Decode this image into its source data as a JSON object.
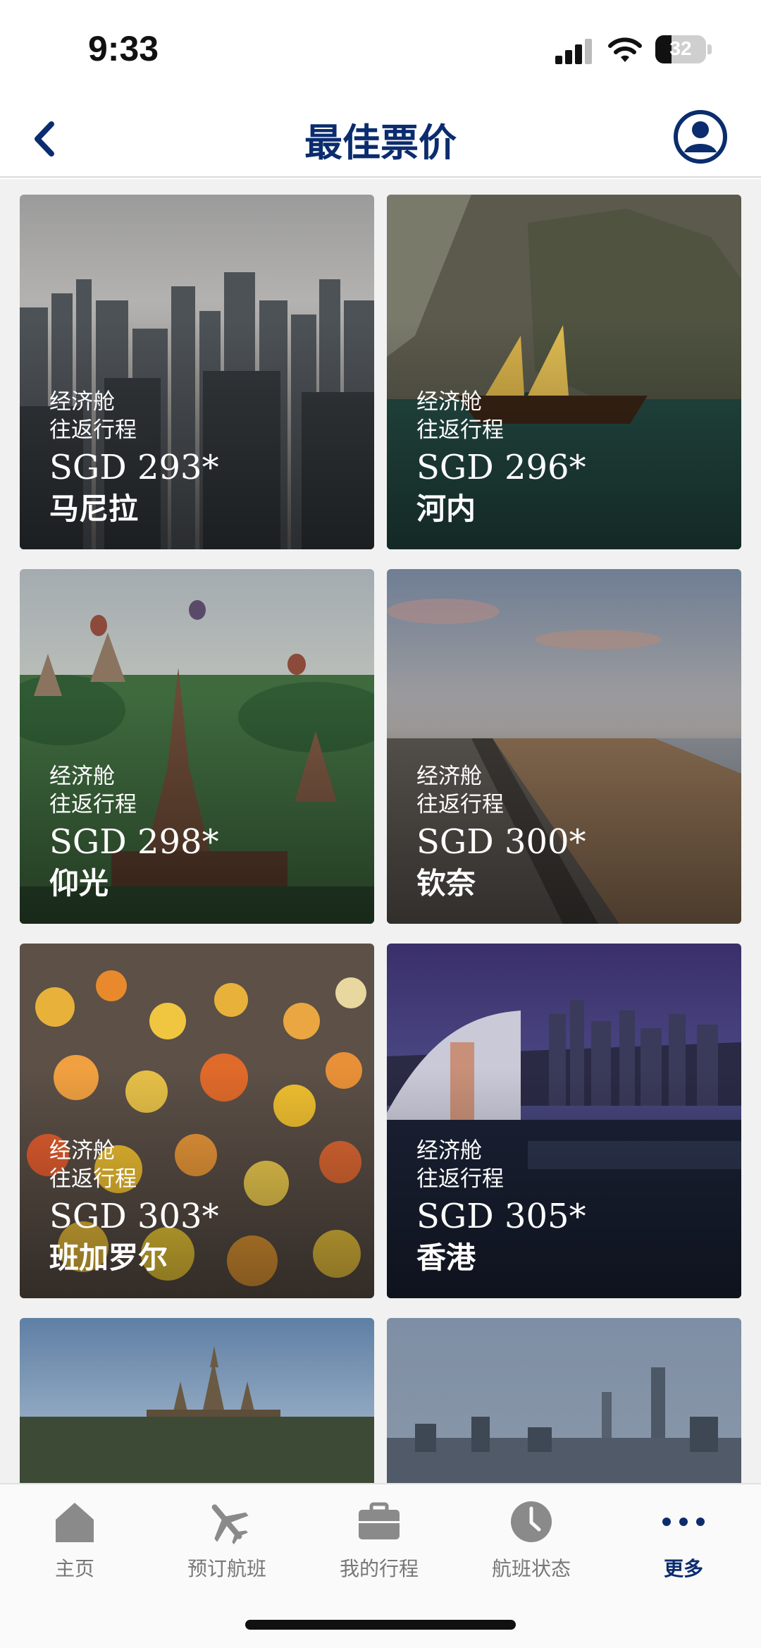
{
  "status_bar": {
    "time": "9:33",
    "battery": "32"
  },
  "header": {
    "title": "最佳票价"
  },
  "fares": [
    {
      "cabin": "经济舱",
      "trip": "往返行程",
      "price": "SGD 293*",
      "city": "马尼拉"
    },
    {
      "cabin": "经济舱",
      "trip": "往返行程",
      "price": "SGD 296*",
      "city": "河内"
    },
    {
      "cabin": "经济舱",
      "trip": "往返行程",
      "price": "SGD 298*",
      "city": "仰光"
    },
    {
      "cabin": "经济舱",
      "trip": "往返行程",
      "price": "SGD 300*",
      "city": "钦奈"
    },
    {
      "cabin": "经济舱",
      "trip": "往返行程",
      "price": "SGD 303*",
      "city": "班加罗尔"
    },
    {
      "cabin": "经济舱",
      "trip": "往返行程",
      "price": "SGD 305*",
      "city": "香港"
    }
  ],
  "tabs": [
    {
      "label": "主页",
      "icon": "home-icon"
    },
    {
      "label": "预订航班",
      "icon": "plane-icon"
    },
    {
      "label": "我的行程",
      "icon": "briefcase-icon"
    },
    {
      "label": "航班状态",
      "icon": "clock-icon"
    },
    {
      "label": "更多",
      "icon": "more-icon",
      "active": true
    }
  ],
  "colors": {
    "brand": "#0b2c6e",
    "inactive": "#777777"
  }
}
